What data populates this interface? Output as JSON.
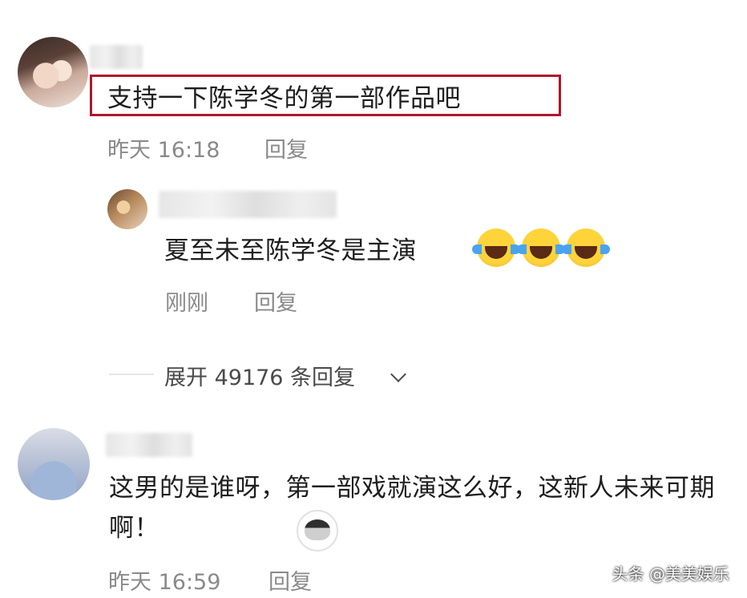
{
  "comments": [
    {
      "text": "支持一下陈学冬的第一部作品吧",
      "time": "昨天 16:18",
      "reply_label": "回复",
      "highlighted": true,
      "highlight_color": "#b0162a"
    },
    {
      "text": "夏至未至陈学冬是主演",
      "emoji": [
        "laughing-crying-emoji",
        "laughing-crying-emoji",
        "laughing-crying-emoji"
      ],
      "time": "刚刚",
      "reply_label": "回复"
    },
    {
      "text": "这男的是谁呀，第一部戏就演这么好，这新人未来可期啊！",
      "emoji": [
        "husky-emoji"
      ],
      "time": "昨天 16:59",
      "reply_label": "回复"
    }
  ],
  "expand_replies": "展开 49176 条回复",
  "watermark": "头条 @美美娱乐"
}
